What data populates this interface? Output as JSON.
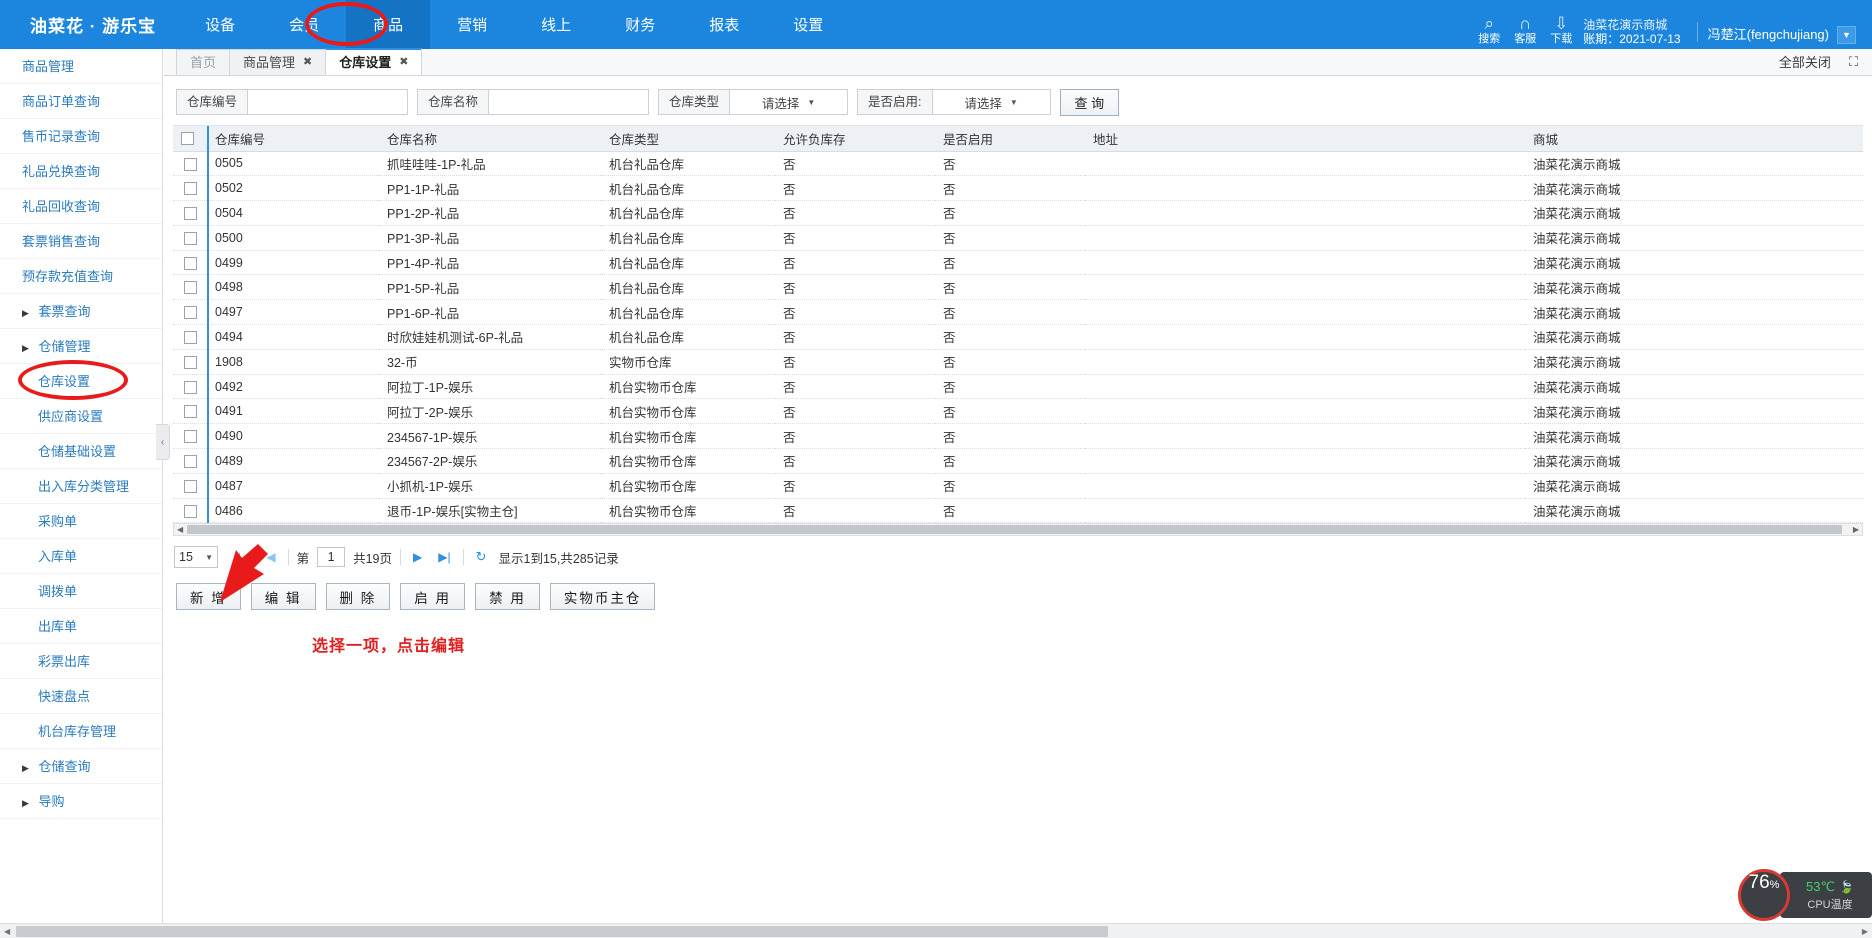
{
  "header": {
    "brand": "油菜花 · 游乐宝",
    "nav": [
      {
        "label": "设备",
        "active": false
      },
      {
        "label": "会员",
        "active": false
      },
      {
        "label": "商品",
        "active": true
      },
      {
        "label": "营销",
        "active": false
      },
      {
        "label": "线上",
        "active": false
      },
      {
        "label": "财务",
        "active": false
      },
      {
        "label": "报表",
        "active": false
      },
      {
        "label": "设置",
        "active": false
      }
    ],
    "tools": [
      {
        "icon": "search-icon",
        "glyph": "⌕",
        "caption": "搜索"
      },
      {
        "icon": "headset-icon",
        "glyph": "∩",
        "caption": "客服"
      },
      {
        "icon": "download-icon",
        "glyph": "⇩",
        "caption": "下载"
      }
    ],
    "shop_name": "油菜花演示商城",
    "period_label": "账期：2021-07-13",
    "user": "冯楚江(fengchujiang)",
    "caret": "▼",
    "bg_color": "#1c86df"
  },
  "sidebar": {
    "items": [
      {
        "label": "商品管理",
        "expandable": false,
        "sub": false
      },
      {
        "label": "商品订单查询",
        "expandable": false,
        "sub": false
      },
      {
        "label": "售币记录查询",
        "expandable": false,
        "sub": false
      },
      {
        "label": "礼品兑换查询",
        "expandable": false,
        "sub": false
      },
      {
        "label": "礼品回收查询",
        "expandable": false,
        "sub": false
      },
      {
        "label": "套票销售查询",
        "expandable": false,
        "sub": false
      },
      {
        "label": "预存款充值查询",
        "expandable": false,
        "sub": false
      },
      {
        "label": "套票查询",
        "expandable": true,
        "sub": false
      },
      {
        "label": "仓储管理",
        "expandable": true,
        "sub": false
      },
      {
        "label": "仓库设置",
        "expandable": false,
        "sub": true
      },
      {
        "label": "供应商设置",
        "expandable": false,
        "sub": true
      },
      {
        "label": "仓储基础设置",
        "expandable": false,
        "sub": true
      },
      {
        "label": "出入库分类管理",
        "expandable": false,
        "sub": true
      },
      {
        "label": "采购单",
        "expandable": false,
        "sub": true
      },
      {
        "label": "入库单",
        "expandable": false,
        "sub": true
      },
      {
        "label": "调拨单",
        "expandable": false,
        "sub": true
      },
      {
        "label": "出库单",
        "expandable": false,
        "sub": true
      },
      {
        "label": "彩票出库",
        "expandable": false,
        "sub": true
      },
      {
        "label": "快速盘点",
        "expandable": false,
        "sub": true
      },
      {
        "label": "机台库存管理",
        "expandable": false,
        "sub": true
      },
      {
        "label": "仓储查询",
        "expandable": true,
        "sub": false
      },
      {
        "label": "导购",
        "expandable": true,
        "sub": false
      }
    ],
    "collapse_icon": "‹"
  },
  "tabs": {
    "items": [
      {
        "label": "首页",
        "closable": false,
        "active": false
      },
      {
        "label": "商品管理",
        "closable": true,
        "active": false
      },
      {
        "label": "仓库设置",
        "closable": true,
        "active": true
      }
    ],
    "close_x": "✖",
    "close_all": "全部关闭",
    "expand_icon": "⛶"
  },
  "filters": {
    "code": {
      "label": "仓库编号",
      "value": "",
      "placeholder": ""
    },
    "name": {
      "label": "仓库名称",
      "value": "",
      "placeholder": ""
    },
    "type": {
      "label": "仓库类型",
      "value": "请选择",
      "caret": "▼"
    },
    "enabled": {
      "label": "是否启用:",
      "value": "请选择",
      "caret": "▼"
    },
    "query_button": "查 询"
  },
  "table": {
    "columns": [
      "仓库编号",
      "仓库名称",
      "仓库类型",
      "允许负库存",
      "是否启用",
      "地址",
      "商城"
    ],
    "rows": [
      {
        "code": "0505",
        "name": "抓哇哇哇-1P-礼品",
        "type": "机台礼品仓库",
        "neg": "否",
        "enabled": "否",
        "address": "",
        "mall": "油菜花演示商城"
      },
      {
        "code": "0502",
        "name": "PP1-1P-礼品",
        "type": "机台礼品仓库",
        "neg": "否",
        "enabled": "否",
        "address": "",
        "mall": "油菜花演示商城"
      },
      {
        "code": "0504",
        "name": "PP1-2P-礼品",
        "type": "机台礼品仓库",
        "neg": "否",
        "enabled": "否",
        "address": "",
        "mall": "油菜花演示商城"
      },
      {
        "code": "0500",
        "name": "PP1-3P-礼品",
        "type": "机台礼品仓库",
        "neg": "否",
        "enabled": "否",
        "address": "",
        "mall": "油菜花演示商城"
      },
      {
        "code": "0499",
        "name": "PP1-4P-礼品",
        "type": "机台礼品仓库",
        "neg": "否",
        "enabled": "否",
        "address": "",
        "mall": "油菜花演示商城"
      },
      {
        "code": "0498",
        "name": "PP1-5P-礼品",
        "type": "机台礼品仓库",
        "neg": "否",
        "enabled": "否",
        "address": "",
        "mall": "油菜花演示商城"
      },
      {
        "code": "0497",
        "name": "PP1-6P-礼品",
        "type": "机台礼品仓库",
        "neg": "否",
        "enabled": "否",
        "address": "",
        "mall": "油菜花演示商城"
      },
      {
        "code": "0494",
        "name": "时欣娃娃机测试-6P-礼品",
        "type": "机台礼品仓库",
        "neg": "否",
        "enabled": "否",
        "address": "",
        "mall": "油菜花演示商城"
      },
      {
        "code": "1908",
        "name": "32-币",
        "type": "实物币仓库",
        "neg": "否",
        "enabled": "否",
        "address": "",
        "mall": "油菜花演示商城"
      },
      {
        "code": "0492",
        "name": "阿拉丁-1P-娱乐",
        "type": "机台实物币仓库",
        "neg": "否",
        "enabled": "否",
        "address": "",
        "mall": "油菜花演示商城"
      },
      {
        "code": "0491",
        "name": "阿拉丁-2P-娱乐",
        "type": "机台实物币仓库",
        "neg": "否",
        "enabled": "否",
        "address": "",
        "mall": "油菜花演示商城"
      },
      {
        "code": "0490",
        "name": "234567-1P-娱乐",
        "type": "机台实物币仓库",
        "neg": "否",
        "enabled": "否",
        "address": "",
        "mall": "油菜花演示商城"
      },
      {
        "code": "0489",
        "name": "234567-2P-娱乐",
        "type": "机台实物币仓库",
        "neg": "否",
        "enabled": "否",
        "address": "",
        "mall": "油菜花演示商城"
      },
      {
        "code": "0487",
        "name": "小抓机-1P-娱乐",
        "type": "机台实物币仓库",
        "neg": "否",
        "enabled": "否",
        "address": "",
        "mall": "油菜花演示商城"
      },
      {
        "code": "0486",
        "name": "退币-1P-娱乐[实物主仓]",
        "type": "机台实物币仓库",
        "neg": "否",
        "enabled": "否",
        "address": "",
        "mall": "油菜花演示商城"
      }
    ]
  },
  "pagination": {
    "page_size": "15",
    "first": "|◀",
    "prev": "◀",
    "page_prefix": "第",
    "page_value": "1",
    "page_total": "共19页",
    "next": "▶",
    "last": "▶|",
    "refresh": "↻",
    "summary": "显示1到15,共285记录"
  },
  "actions": [
    {
      "label": "新 增",
      "name": "add-button"
    },
    {
      "label": "编 辑",
      "name": "edit-button"
    },
    {
      "label": "删 除",
      "name": "delete-button"
    },
    {
      "label": "启 用",
      "name": "enable-button"
    },
    {
      "label": "禁 用",
      "name": "disable-button"
    },
    {
      "label": "实物币主仓",
      "name": "physical-coin-main-warehouse-button"
    }
  ],
  "annotation": {
    "note": "选择一项，点击编辑",
    "color": "#e02020"
  },
  "float_widget": {
    "percent": "76",
    "percent_sign": "%",
    "temperature": "53℃",
    "leaf": "🍃",
    "label": "CPU温度"
  }
}
